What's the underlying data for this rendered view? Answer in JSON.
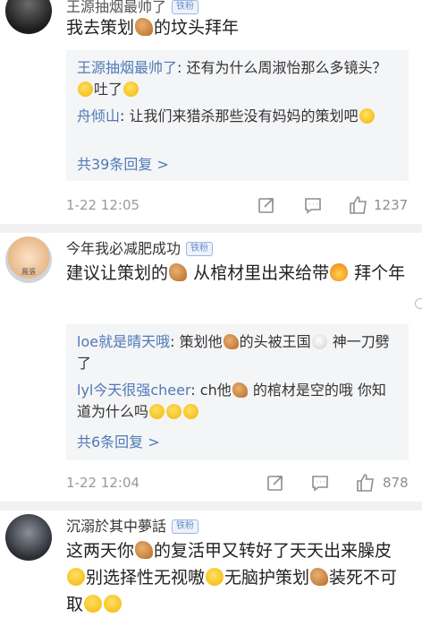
{
  "comments": [
    {
      "username": "王源抽烟最帅了",
      "badge": "铁粉",
      "text_a": "我去策划",
      "text_b": "的坟头拜年",
      "replies": [
        {
          "name": "王源抽烟最帅了",
          "text": ": 还有为什么周淑怡那么多镜头？",
          "text_b": "吐了"
        },
        {
          "name": "舟倾山",
          "text": ": 让我们来猎杀那些没有妈妈的策划吧"
        }
      ],
      "more": "共39条回复 >",
      "time": "1-22 12:05",
      "likes": "1237"
    },
    {
      "username": "今年我必减肥成功",
      "badge": "铁粉",
      "avatar_label": "鳳張",
      "text_a": "建议让策划的",
      "text_b": "从棺材里出来给带",
      "text_c": "拜个年",
      "replies": [
        {
          "name": "loe就是晴天哦",
          "text": ": 策划他",
          "text_b": "的头被王国",
          "text_c": "神一刀劈了"
        },
        {
          "name": "lyl今天很强cheer",
          "text": ": ch他",
          "text_b": "的棺材是空的哦 你知道为什么吗"
        }
      ],
      "more": "共6条回复 >",
      "time": "1-22 12:04",
      "likes": "878"
    },
    {
      "username": "沉溺於其中夢話",
      "badge": "铁粉",
      "text_a": "这两天你",
      "text_b": "的复活甲又转好了天天出来臊皮",
      "text_c": "别选择性无视嗷",
      "text_d": "无脑护策划",
      "text_e": "装死",
      "text_f": "不可取"
    }
  ]
}
